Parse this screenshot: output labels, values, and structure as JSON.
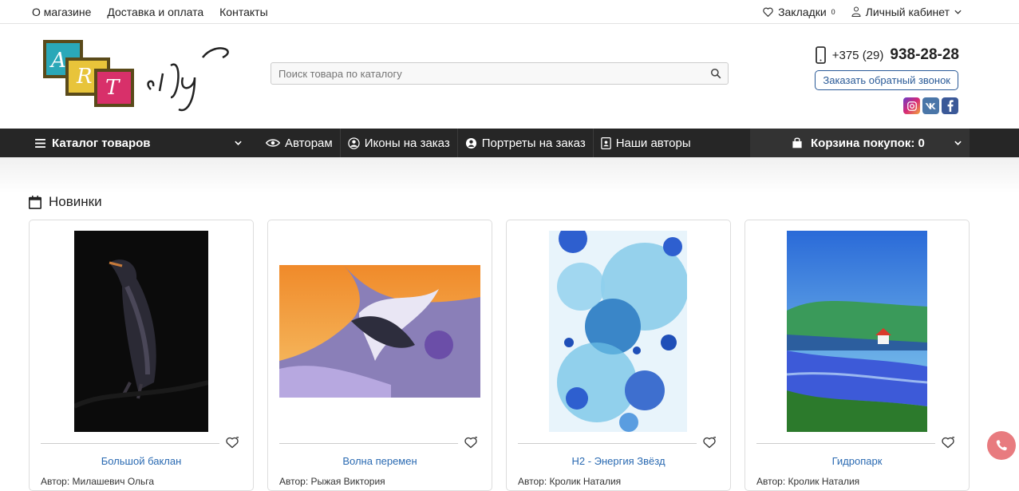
{
  "topbar": {
    "links": [
      "О магазине",
      "Доставка и оплата",
      "Контакты"
    ],
    "bookmarks_label": "Закладки",
    "bookmarks_count": "0",
    "account_label": "Личный кабинет"
  },
  "header": {
    "logo_text": "ART city",
    "search_placeholder": "Поиск товара по каталогу",
    "phone_prefix": "+375 (29)",
    "phone_number": "938-28-28",
    "callback_label": "Заказать обратный звонок",
    "social": [
      "instagram-icon",
      "vk-icon",
      "facebook-icon"
    ]
  },
  "nav": {
    "catalog_label": "Каталог товаров",
    "items": [
      {
        "label": "Авторам",
        "icon": "eye-icon"
      },
      {
        "label": "Иконы на заказ",
        "icon": "user-circle-icon"
      },
      {
        "label": "Портреты на заказ",
        "icon": "user-circle-icon"
      },
      {
        "label": "Наши авторы",
        "icon": "id-card-icon"
      }
    ],
    "cart_label": "Корзина покупок: 0"
  },
  "section": {
    "title": "Новинки"
  },
  "products": [
    {
      "title": "Большой баклан",
      "author": "Автор: Милашевич Ольга"
    },
    {
      "title": "Волна перемен",
      "author": "Автор: Рыжая Виктория"
    },
    {
      "title": "H2 - Энергия Звёзд",
      "author": "Автор: Кролик Наталия"
    },
    {
      "title": "Гидропарк",
      "author": "Автор: Кролик Наталия"
    }
  ],
  "colors": {
    "nav_bg": "#262626",
    "link_blue": "#2a6ab2",
    "callback_border": "#2a5a97",
    "fab": "#e87b7f"
  }
}
